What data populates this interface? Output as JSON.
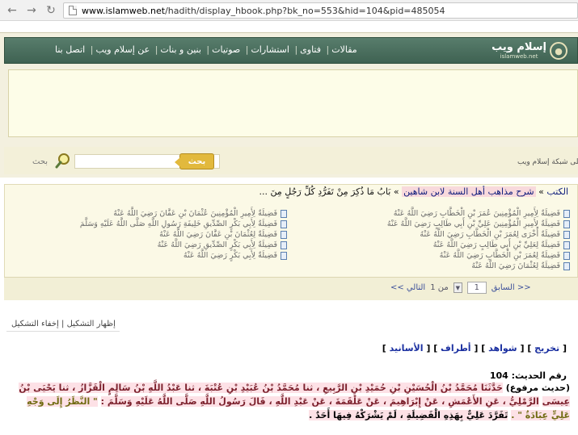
{
  "browser": {
    "url_prefix": "www.islamweb.net",
    "url_path": "/hadith/display_hbook.php?bk_no=553&hid=104&pid=485054",
    "back_icon": "back-arrow-icon",
    "forward_icon": "forward-arrow-icon",
    "reload_icon": "reload-icon"
  },
  "header": {
    "logo_ar": "إسلام ويب",
    "logo_en": "islamweb.net",
    "nav": [
      "مقالات",
      "فتاوى",
      "استشارات",
      "صوتيات",
      "بنين و بنات",
      "عن إسلام ويب",
      "اتصل بنا"
    ]
  },
  "search": {
    "button_label": "بحث",
    "label": "بحث",
    "scope_text": "على شبكة إسلام ويب"
  },
  "breadcrumb": {
    "root": "الكتب",
    "book": "شرح مذاهب أهل السنة لابن شاهين",
    "chapter": "بَابُ مَا ذُكِرَ مِنْ تَفَرُّدِ كُلِّ رَجُلٍ مِنَ ..."
  },
  "chapters_right": [
    "فَضِيلَةٌ لِأَمِيرِ الْمُؤْمِنِينَ عُمَرَ بْنِ الْخَطَّابِ رَضِيَ اللَّهُ عَنْهُ",
    "فَضِيلَةٌ لِأَمِيرِ الْمُؤْمِنِينَ عَلِيِّ بْنِ أَبِي طَالِبٍ رَضِيَ اللَّهُ عَنْهُ",
    "فَضِيلَةٌ أُخْرَى لِعُمَرَ بْنِ الْخَطَّابِ رَضِيَ اللَّهُ عَنْهُ",
    "فَضِيلَةٌ لِعَلِيِّ بْنِ أَبِي طَالِبٍ رَضِيَ اللَّهُ عَنْهُ",
    "فَضِيلَةٌ لِعُمَرَ بْنِ الْخَطَّابِ رَضِيَ اللَّهُ عَنْهُ",
    "فَضِيلَةٌ لِعُثْمَانَ رَضِيَ اللَّهُ عَنْهُ"
  ],
  "chapters_left": [
    "فَضِيلَةٌ لِأَمِيرِ الْمُؤْمِنِينَ عُثْمَانَ بْنِ عَفَّانَ رَضِيَ اللَّهُ عَنْهُ",
    "فَضِيلَةٌ لِأَبِي بَكْرٍ الصِّدِّيقِ خَلِيفَةِ رَسُولِ اللَّهِ صَلَّى اللَّهُ عَلَيْهِ وَسَلَّمَ",
    "فَضِيلَةٌ لِعُثْمَانَ بْنِ عَفَّانَ رَضِيَ اللَّهُ عَنْهُ",
    "فَضِيلَةٌ لِأَبِي بَكْرٍ الصِّدِّيقِ رَضِيَ اللَّهُ عَنْهُ",
    "فَضِيلَةٌ لِأَبِي بَكْرٍ رَضِيَ اللَّهُ عَنْهُ"
  ],
  "pager": {
    "prev": "<< السابق",
    "page": "1",
    "of_label": "من 1",
    "next": "التالي >>"
  },
  "tashkeel": {
    "show": "إظهار التشكيل",
    "hide": "إخفاء التشكيل"
  },
  "tools": {
    "takhrij": "تخريج",
    "shawahid": "شواهد",
    "atraf": "أطراف",
    "asanid": "الأسانيد"
  },
  "hadith": {
    "number_label": "رقم الحديث: 104",
    "type": "(حديث مرفوع)",
    "isnad_1": "حَدَّثَنَا مُحَمَّدُ بْنُ الْحُسَيْنِ بْنِ حُمَيْدِ بْنِ الرَّبِيعِ ، ثنا مُحَمَّدُ بْنُ عُبَيْدِ بْنِ عُتْبَةَ ، ثنا عَبْدُ اللَّهِ بْنُ سَالِمٍ الْقَزَّازُ ، ثنا يَحْيَى بْنُ عِيسَى",
    "isnad_2": "الرَّمْلِيُّ ، عَنِ الأَعْمَشِ ، عَنْ إِبْرَاهِيمَ ، عَنْ عَلْقَمَةَ ، عَنْ عَبْدِ اللَّهِ ، قَالَ رَسُولُ اللَّهِ صَلَّى اللَّهُ عَلَيْهِ وَسَلَّمَ :",
    "matn": "\" النَّظَرُ إِلَى وَجْهِ عَلِيٍّ عِبَادَةٌ \" .",
    "comment": "تَفَرَّدَ عَلِيٌّ بِهَذِهِ الْفَضِيلَةِ ، لَمْ يَشْرَكْهُ فِيهَا أَحَدٌ ."
  }
}
